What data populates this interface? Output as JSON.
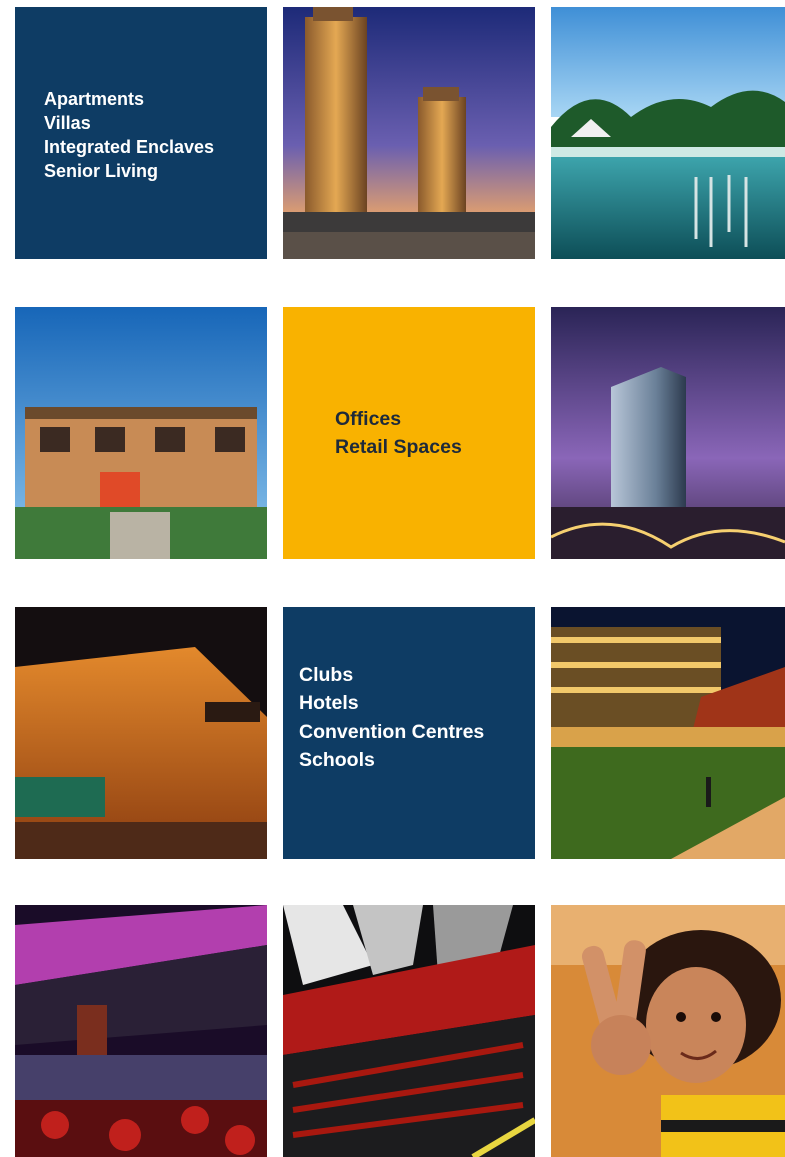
{
  "residential": {
    "lines": [
      "Apartments",
      "Villas",
      "Integrated Enclaves",
      "Senior Living"
    ],
    "color": "#0e3c64"
  },
  "commercial": {
    "lines": [
      "Offices",
      "Retail Spaces"
    ],
    "color": "#f9b200"
  },
  "hospitality": {
    "lines": [
      "Clubs",
      "Hotels",
      "Convention Centres",
      "Schools"
    ],
    "color": "#0e3c64"
  },
  "photos": [
    {
      "name": "twin-towers-photo"
    },
    {
      "name": "pool-photo"
    },
    {
      "name": "villas-photo"
    },
    {
      "name": "office-tower-photo"
    },
    {
      "name": "mall-photo"
    },
    {
      "name": "hotel-lawn-photo"
    },
    {
      "name": "convention-hall-photo"
    },
    {
      "name": "auditorium-photo"
    },
    {
      "name": "child-photo"
    }
  ]
}
